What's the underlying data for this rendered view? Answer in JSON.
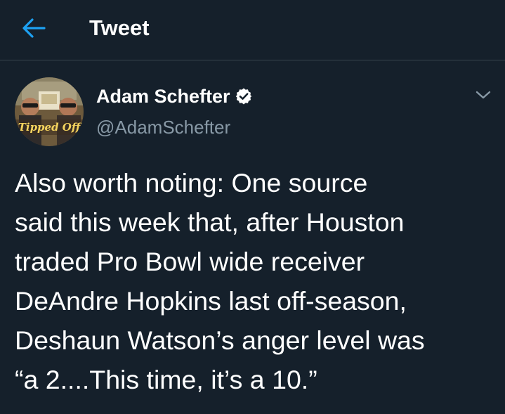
{
  "header": {
    "title": "Tweet",
    "back_icon": "arrow-left-icon",
    "accent_color": "#1da1f2"
  },
  "tweet": {
    "author": {
      "display_name": "Adam Schefter",
      "handle": "@AdamSchefter",
      "verified": true,
      "avatar_text": "Tipped Off"
    },
    "more_icon": "chevron-down-icon",
    "text": "Also worth noting: One source\nsaid this week that, after Houston\ntraded Pro Bowl wide receiver\nDeAndre Hopkins last off-season,\nDeshaun Watson’s anger level was\n“a 2....This time, it’s a 10.”"
  },
  "colors": {
    "background": "#15202b",
    "divider": "#38444d",
    "secondary_text": "#8899a6",
    "primary_text": "#ffffff"
  }
}
